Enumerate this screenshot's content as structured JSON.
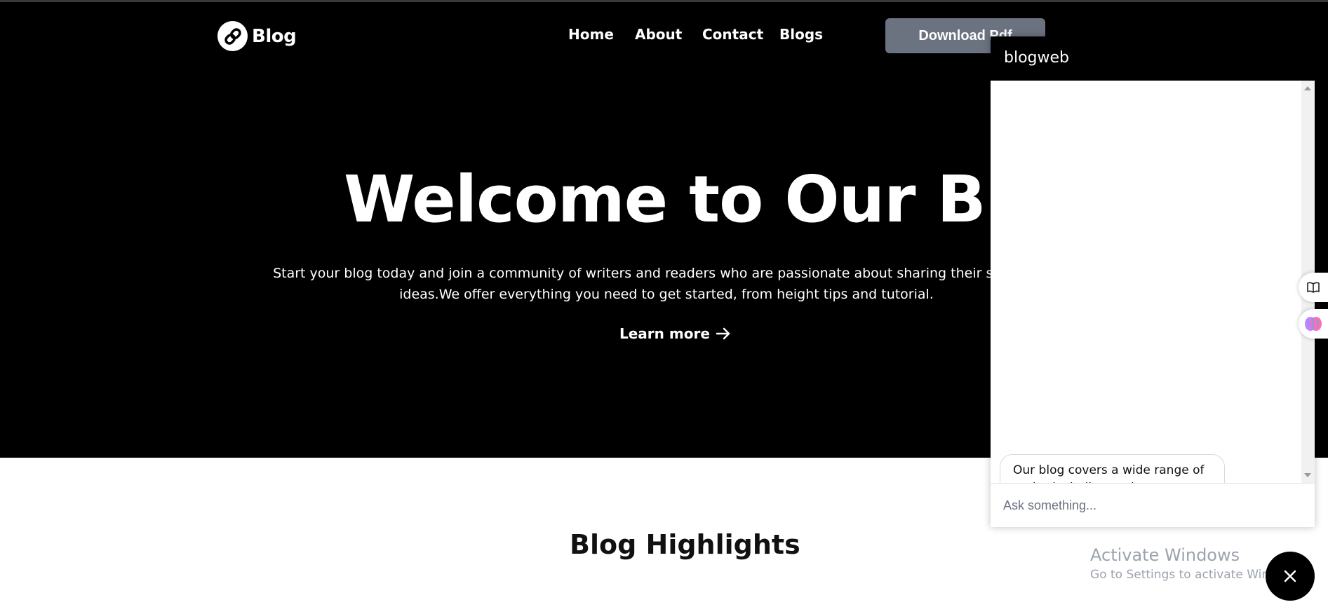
{
  "logo": {
    "text": "Blog",
    "icon": "link-icon"
  },
  "nav": {
    "items": [
      {
        "label": "Home"
      },
      {
        "label": "About"
      },
      {
        "label": "Contact"
      },
      {
        "label": "Blogs"
      }
    ],
    "download_label": "Download Pdf"
  },
  "hero": {
    "title": "Welcome to Our Blog",
    "description": "Start your blog today and join a community of writers and readers who are passionate about sharing their stories and ideas.We offer everything you need to get started, from height tips and tutorial.",
    "learn_more": "Learn more"
  },
  "highlights": {
    "title": "Blog Highlights"
  },
  "chat": {
    "title": "blogweb",
    "bot_message": "Our blog covers a wide range of topics including such as technology, travel, lifestyle, etc.",
    "input_placeholder": "Ask something..."
  },
  "side_tabs": [
    {
      "icon": "book-icon"
    },
    {
      "icon": "brain-icon"
    }
  ],
  "watermark": {
    "line1": "Activate Windows",
    "line2": "Go to Settings to activate Windows."
  },
  "colors": {
    "hero_bg": "#000000",
    "button_bg": "#6b7280",
    "chat_header_bg": "#000000"
  }
}
